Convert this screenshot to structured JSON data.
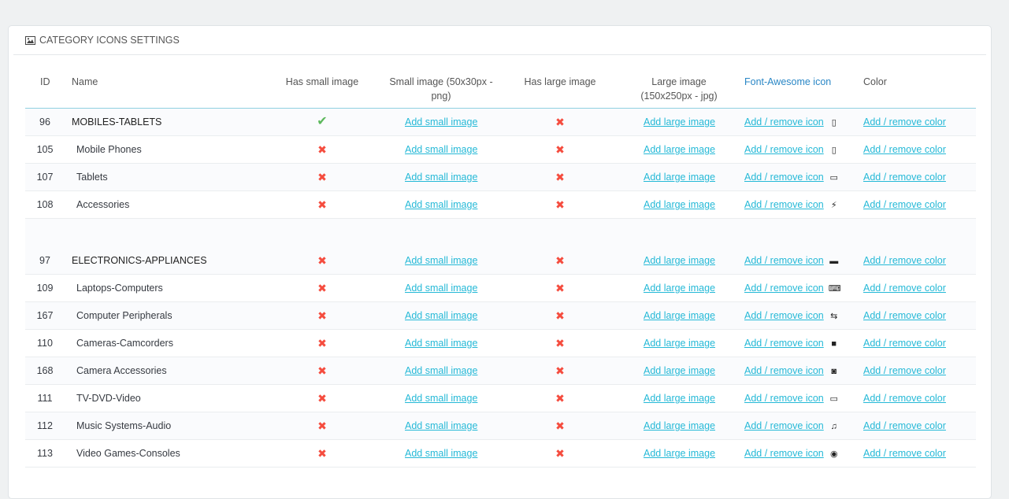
{
  "panel": {
    "title": "CATEGORY ICONS SETTINGS",
    "title_icon": "picture-icon"
  },
  "columns": {
    "id": "ID",
    "name": "Name",
    "has_small": "Has small image",
    "small_line1": "Small image (50x30px -",
    "small_line2": "png)",
    "has_large": "Has large image",
    "large_line1": "Large image",
    "large_line2": "(150x250px - jpg)",
    "fa": "Font-Awesome icon",
    "color": "Color"
  },
  "labels": {
    "add_small": "Add small image",
    "add_large": "Add large image",
    "add_icon": "Add / remove icon",
    "add_color": "Add / remove color"
  },
  "marks": {
    "yes": "✔",
    "no": "✖"
  },
  "colors": {
    "accent": "#25b9d7",
    "header_link": "#2a87c6",
    "no": "#f54c3e",
    "yes": "#5cb85c"
  },
  "rows": [
    {
      "id": "96",
      "name": "MOBILES-TABLETS",
      "parent": true,
      "has_small": true,
      "has_large": false,
      "icon": "mobile-icon",
      "glyph": "▯"
    },
    {
      "id": "105",
      "name": "Mobile Phones",
      "parent": false,
      "has_small": false,
      "has_large": false,
      "icon": "mobile-phone-icon",
      "glyph": "▯"
    },
    {
      "id": "107",
      "name": "Tablets",
      "parent": false,
      "has_small": false,
      "has_large": false,
      "icon": "tablet-icon",
      "glyph": "▭"
    },
    {
      "id": "108",
      "name": "Accessories",
      "parent": false,
      "has_small": false,
      "has_large": false,
      "icon": "plug-icon",
      "glyph": "⚡"
    },
    {
      "id": "97",
      "name": "ELECTRONICS-APPLIANCES",
      "parent": true,
      "has_small": false,
      "has_large": false,
      "icon": "desktop-icon",
      "glyph": "▬"
    },
    {
      "id": "109",
      "name": "Laptops-Computers",
      "parent": false,
      "has_small": false,
      "has_large": false,
      "icon": "laptop-icon",
      "glyph": "⌨"
    },
    {
      "id": "167",
      "name": "Computer Peripherals",
      "parent": false,
      "has_small": false,
      "has_large": false,
      "icon": "usb-icon",
      "glyph": "⇆"
    },
    {
      "id": "110",
      "name": "Cameras-Camcorders",
      "parent": false,
      "has_small": false,
      "has_large": false,
      "icon": "video-camera-icon",
      "glyph": "■"
    },
    {
      "id": "168",
      "name": "Camera Accessories",
      "parent": false,
      "has_small": false,
      "has_large": false,
      "icon": "camera-icon",
      "glyph": "◙"
    },
    {
      "id": "111",
      "name": "TV-DVD-Video",
      "parent": false,
      "has_small": false,
      "has_large": false,
      "icon": "monitor-icon",
      "glyph": "▭"
    },
    {
      "id": "112",
      "name": "Music Systems-Audio",
      "parent": false,
      "has_small": false,
      "has_large": false,
      "icon": "music-icon",
      "glyph": "♫"
    },
    {
      "id": "113",
      "name": "Video Games-Consoles",
      "parent": false,
      "has_small": false,
      "has_large": false,
      "icon": "gamepad-icon",
      "glyph": "◉"
    }
  ]
}
